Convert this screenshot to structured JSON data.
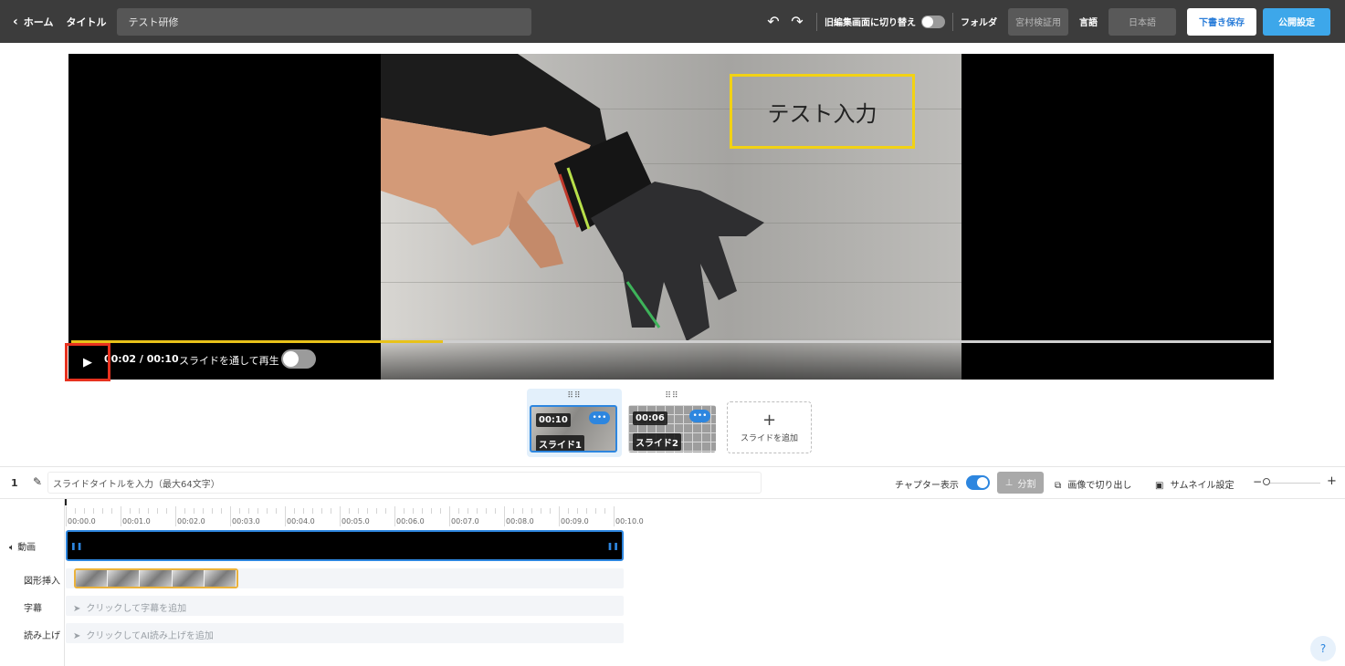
{
  "header": {
    "home_label": "ホーム",
    "title_label": "タイトル",
    "title_value": "テスト研修",
    "undo_icon": "undo-icon",
    "redo_icon": "redo-icon",
    "legacy_switch_label": "旧編集画面に切り替え",
    "folder_label": "フォルダ",
    "folder_value": "宮村検証用",
    "language_label": "言語",
    "language_value": "日本語",
    "save_draft_label": "下書き保存",
    "publish_label": "公開設定"
  },
  "player": {
    "overlay_text": "テスト入力",
    "timecode": "00:02 / 00:10",
    "slide_through_label": "スライドを通して再生",
    "progress_fraction": 0.31
  },
  "slides": [
    {
      "duration": "00:10",
      "name": "スライド1",
      "selected": true
    },
    {
      "duration": "00:06",
      "name": "スライド2",
      "selected": false
    }
  ],
  "add_slide_label": "スライドを追加",
  "slide_toolbar": {
    "slide_number": "1",
    "title_placeholder": "スライドタイトルを入力（最大64文字）",
    "chapter_label": "チャプター表示",
    "split_label": "分割",
    "crop_label": "画像で切り出し",
    "thumbnail_label": "サムネイル設定",
    "zoom_minus": "−",
    "zoom_plus": "+"
  },
  "timeline": {
    "ticks": [
      "00:00.0",
      "00:01.0",
      "00:02.0",
      "00:03.0",
      "00:04.0",
      "00:05.0",
      "00:06.0",
      "00:07.0",
      "00:08.0",
      "00:09.0",
      "00:10.0"
    ],
    "tracks": {
      "video": "動画",
      "shape": "図形挿入",
      "subtitle": "字幕",
      "narration": "読み上げ"
    },
    "subtitle_hint": "クリックして字幕を追加",
    "narration_hint": "クリックしてAI読み上げを追加"
  },
  "help_label": "?"
}
